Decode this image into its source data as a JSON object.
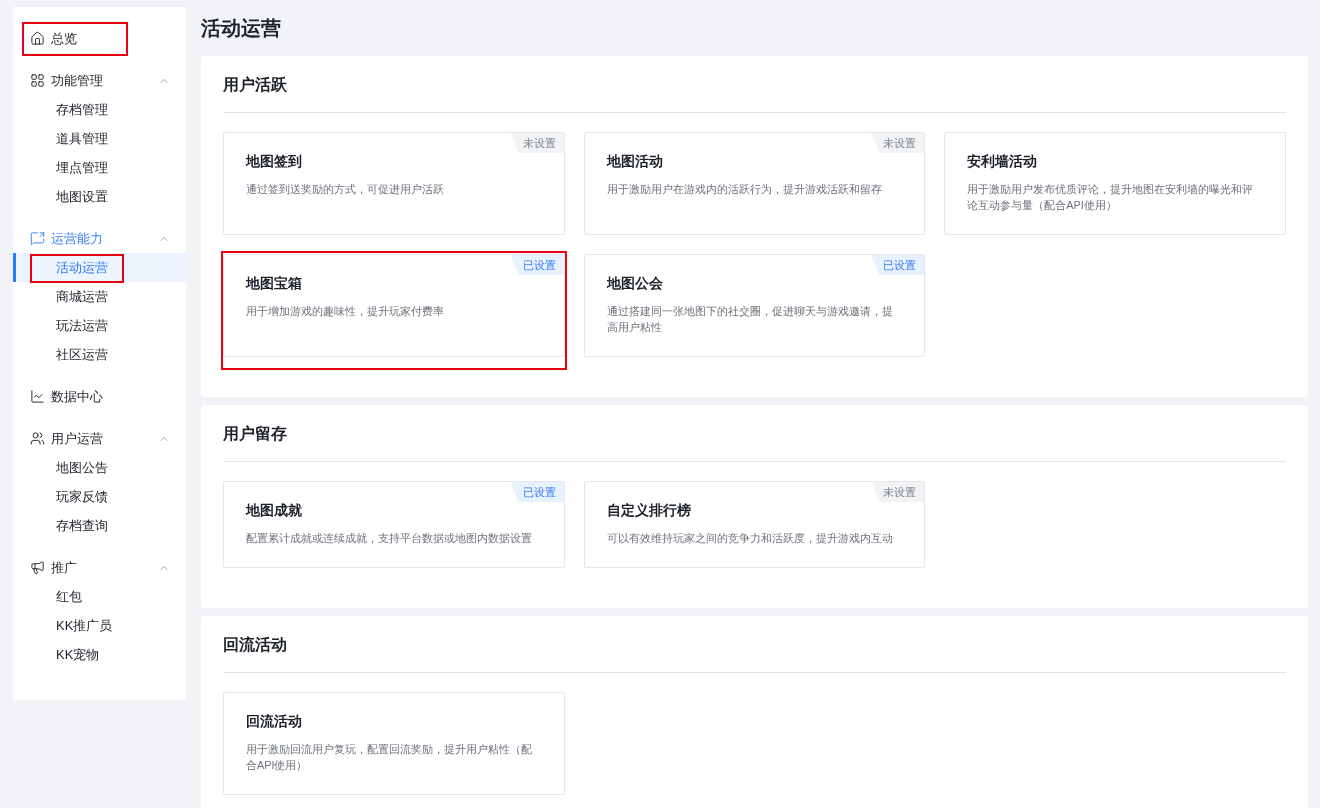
{
  "sidebar": {
    "items": [
      {
        "kind": "link",
        "label": "总览",
        "selected": false,
        "highlighted": true
      },
      {
        "kind": "group",
        "label": "功能管理",
        "active": false,
        "expanded": true,
        "children": [
          {
            "label": "存档管理",
            "selected": false,
            "highlighted": false
          },
          {
            "label": "道具管理",
            "selected": false,
            "highlighted": false
          },
          {
            "label": "埋点管理",
            "selected": false,
            "highlighted": false
          },
          {
            "label": "地图设置",
            "selected": false,
            "highlighted": false
          }
        ]
      },
      {
        "kind": "group",
        "label": "运营能力",
        "active": true,
        "expanded": true,
        "children": [
          {
            "label": "活动运营",
            "selected": true,
            "highlighted": true
          },
          {
            "label": "商城运营",
            "selected": false,
            "highlighted": false
          },
          {
            "label": "玩法运营",
            "selected": false,
            "highlighted": false
          },
          {
            "label": "社区运营",
            "selected": false,
            "highlighted": false
          }
        ]
      },
      {
        "kind": "link",
        "label": "数据中心",
        "selected": false,
        "highlighted": false
      },
      {
        "kind": "group",
        "label": "用户运营",
        "active": false,
        "expanded": true,
        "children": [
          {
            "label": "地图公告",
            "selected": false,
            "highlighted": false
          },
          {
            "label": "玩家反馈",
            "selected": false,
            "highlighted": false
          },
          {
            "label": "存档查询",
            "selected": false,
            "highlighted": false
          }
        ]
      },
      {
        "kind": "group",
        "label": "推广",
        "active": false,
        "expanded": true,
        "children": [
          {
            "label": "红包",
            "selected": false,
            "highlighted": false
          },
          {
            "label": "KK推广员",
            "selected": false,
            "highlighted": false
          },
          {
            "label": "KK宠物",
            "selected": false,
            "highlighted": false
          }
        ]
      }
    ]
  },
  "page_title": "活动运营",
  "sections": [
    {
      "title": "用户活跃",
      "cards": [
        {
          "title": "地图签到",
          "description": "通过签到送奖励的方式，可促进用户活跃",
          "badge": {
            "text": "未设置",
            "configured": false
          },
          "highlighted": false
        },
        {
          "title": "地图活动",
          "description": "用于激励用户在游戏内的活跃行为，提升游戏活跃和留存",
          "badge": {
            "text": "未设置",
            "configured": false
          },
          "highlighted": false
        },
        {
          "title": "安利墙活动",
          "description": "用于激励用户发布优质评论，提升地图在安利墙的曝光和评论互动参与量（配合API使用）",
          "highlighted": false
        },
        {
          "title": "地图宝箱",
          "description": "用于增加游戏的趣味性，提升玩家付费率",
          "badge": {
            "text": "已设置",
            "configured": true
          },
          "highlighted": true
        },
        {
          "title": "地图公会",
          "description": "通过搭建同一张地图下的社交圈，促进聊天与游戏邀请，提高用户粘性",
          "badge": {
            "text": "已设置",
            "configured": true
          },
          "highlighted": false
        }
      ]
    },
    {
      "title": "用户留存",
      "cards": [
        {
          "title": "地图成就",
          "description": "配置累计成就或连续成就，支持平台数据或地图内数据设置",
          "badge": {
            "text": "已设置",
            "configured": true
          },
          "highlighted": false
        },
        {
          "title": "自定义排行榜",
          "description": "可以有效维持玩家之间的竞争力和活跃度，提升游戏内互动",
          "badge": {
            "text": "未设置",
            "configured": false
          },
          "highlighted": false
        }
      ]
    },
    {
      "title": "回流活动",
      "cards": [
        {
          "title": "回流活动",
          "description": "用于激励回流用户复玩，配置回流奖励，提升用户粘性（配合API使用）",
          "highlighted": false
        }
      ]
    }
  ]
}
